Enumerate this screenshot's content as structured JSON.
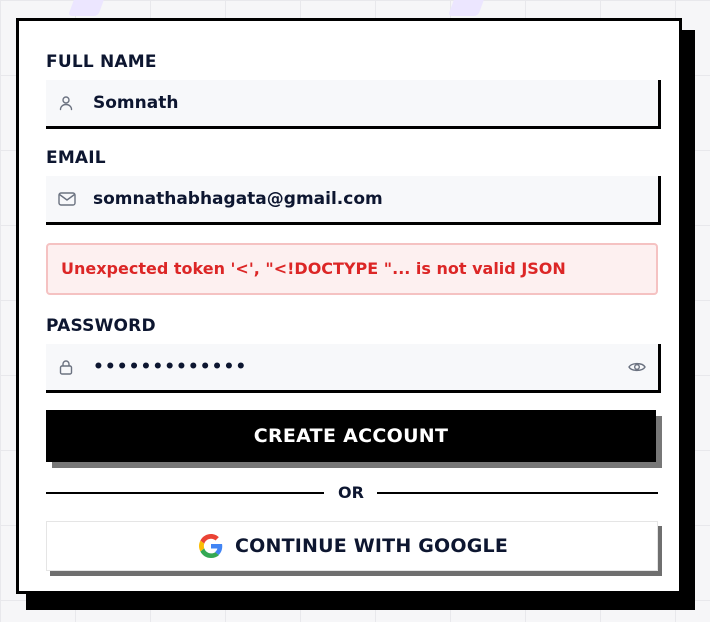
{
  "form": {
    "full_name": {
      "label": "FULL NAME",
      "value": "Somnath",
      "icon": "user-icon"
    },
    "email": {
      "label": "EMAIL",
      "value": "somnathabhagata@gmail.com",
      "icon": "mail-icon"
    },
    "error_message": "Unexpected token '<', \"<!DOCTYPE \"... is not valid JSON",
    "password": {
      "label": "PASSWORD",
      "value": "•••••••••••••",
      "icon": "lock-icon",
      "toggle_icon": "eye-icon"
    },
    "submit_label": "CREATE ACCOUNT",
    "divider_text": "OR",
    "google_label": "CONTINUE WITH GOOGLE"
  },
  "colors": {
    "error_text": "#dc2626",
    "error_bg": "#fdf0f0",
    "primary_bg": "#000000",
    "text": "#0d1630"
  }
}
